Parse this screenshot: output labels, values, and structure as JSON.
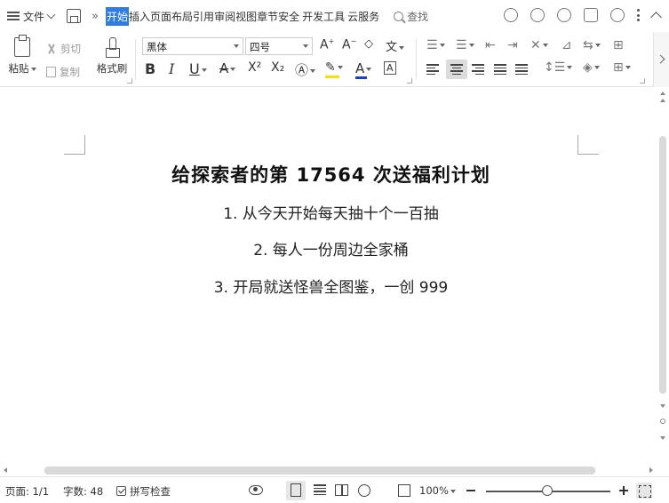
{
  "menubar": {
    "file_label": "文件",
    "tabs": [
      "开始",
      "插入",
      "页面",
      "布局",
      "引用",
      "审阅",
      "视图",
      "章节",
      "安全",
      "开发工具",
      "云服务"
    ],
    "active_tab": "开始",
    "search_label": "查找"
  },
  "ribbon": {
    "paste_label": "粘贴",
    "cut_label": "剪切",
    "copy_label": "复制",
    "format_painter_label": "格式刷",
    "font_name": "黑体",
    "font_size": "四号",
    "bold": "B",
    "italic": "I",
    "underline": "U",
    "superscript": "X²",
    "subscript": "X₂",
    "font_color_letter": "A",
    "highlight_color": "#f2e500",
    "font_color": "#1c3fd6"
  },
  "document": {
    "title": "给探索者的第 17564 次送福利计划",
    "lines": [
      "1. 从今天开始每天抽十个一百抽",
      "2. 每人一份周边全家桶",
      "3. 开局就送怪兽全图鉴，一创 999"
    ]
  },
  "statusbar": {
    "page": "页面: 1/1",
    "word_count": "字数: 48",
    "spellcheck": "拼写检查",
    "zoom": "100%"
  }
}
